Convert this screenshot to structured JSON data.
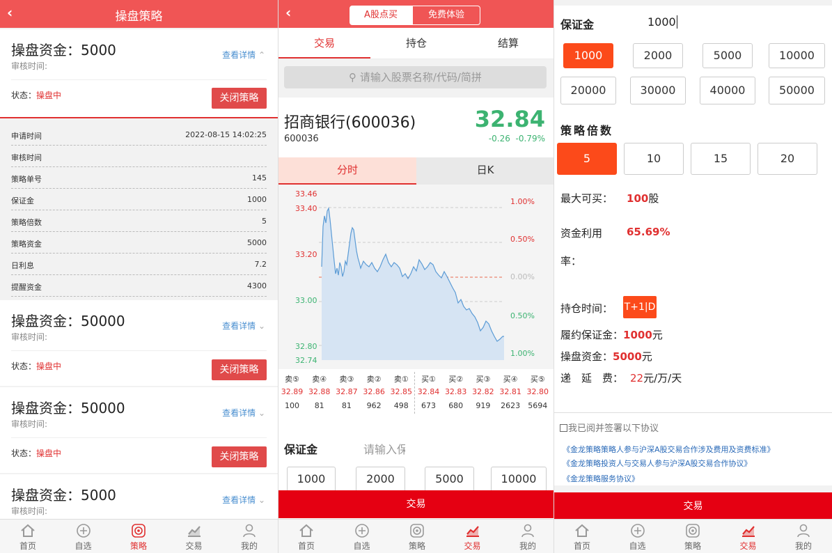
{
  "panel1": {
    "title": "操盘策略",
    "cards": [
      {
        "fund": "操盘资金：5000",
        "audit": "审核时间:",
        "detail": "查看详情",
        "status_label": "状态：",
        "status": "操盘中",
        "close": "关闭策略"
      },
      {
        "fund": "操盘资金：50000",
        "audit": "审核时间:",
        "detail": "查看详情",
        "status_label": "状态：",
        "status": "操盘中",
        "close": "关闭策略"
      },
      {
        "fund": "操盘资金：50000",
        "audit": "审核时间:",
        "detail": "查看详情",
        "status_label": "状态：",
        "status": "操盘中",
        "close": "关闭策略"
      },
      {
        "fund": "操盘资金：5000",
        "audit": "审核时间:",
        "detail": "查看详情"
      }
    ],
    "details": [
      {
        "k": "申请时间",
        "v": "2022-08-15 14:02:25"
      },
      {
        "k": "审核时间",
        "v": ""
      },
      {
        "k": "策略单号",
        "v": "145"
      },
      {
        "k": "保证金",
        "v": "1000"
      },
      {
        "k": "策略倍数",
        "v": "5"
      },
      {
        "k": "策略资金",
        "v": "5000"
      },
      {
        "k": "日利息",
        "v": "7.2"
      },
      {
        "k": "提醒资金",
        "v": "4300"
      }
    ]
  },
  "tabbar": [
    {
      "label": "首页",
      "icon": "home-icon"
    },
    {
      "label": "自选",
      "icon": "plus-circle-icon"
    },
    {
      "label": "策略",
      "icon": "target-icon"
    },
    {
      "label": "交易",
      "icon": "trend-chart-icon"
    },
    {
      "label": "我的",
      "icon": "user-icon"
    }
  ],
  "panel2": {
    "seg_left": "A股点买",
    "seg_right": "免费体验",
    "tabs": [
      "交易",
      "持仓",
      "结算"
    ],
    "search_placeholder": "请输入股票名称/代码/简拼",
    "stock_name": "招商银行(600036)",
    "stock_code": "600036",
    "price": "32.84",
    "change": "-0.26",
    "change_pct": "-0.79%",
    "chart_tabs": [
      "分时",
      "日K"
    ],
    "y_left": [
      "33.46",
      "33.40",
      "33.20",
      "33.00",
      "32.80",
      "32.74"
    ],
    "y_right": [
      "1.00%",
      "0.50%",
      "0.00%",
      "0.50%",
      "1.00%"
    ],
    "orderbook": {
      "labels": [
        "卖⑤",
        "卖④",
        "卖③",
        "卖②",
        "卖①",
        "买①",
        "买②",
        "买③",
        "买④",
        "买⑤"
      ],
      "prices": [
        "32.89",
        "32.88",
        "32.87",
        "32.86",
        "32.85",
        "32.84",
        "32.83",
        "32.82",
        "32.81",
        "32.80"
      ],
      "volumes": [
        "100",
        "81",
        "81",
        "962",
        "498",
        "673",
        "680",
        "919",
        "2623",
        "5694"
      ]
    },
    "margin_label": "保证金",
    "margin_placeholder": "请输入保",
    "amounts": [
      "1000",
      "2000",
      "5000",
      "10000"
    ],
    "trade": "交易"
  },
  "panel3": {
    "margin_label": "保证金",
    "margin_value": "1000",
    "amounts": [
      "1000",
      "2000",
      "5000",
      "10000",
      "20000",
      "30000",
      "40000",
      "50000"
    ],
    "multiple_label": "策略倍数",
    "multiples": [
      "5",
      "10",
      "15",
      "20"
    ],
    "max_buy_label": "最大可买：",
    "max_buy_value": "100",
    "max_buy_unit": "股",
    "util_label_1": "资金利用",
    "util_label_2": "率：",
    "util_value": "65.69%",
    "hold_label": "持仓时间：",
    "hold_value": "T+1|D",
    "deposit_label": "履约保证金：",
    "deposit_value": "1000",
    "deposit_unit": "元",
    "fund_label": "操盘资金：",
    "fund_value": "5000",
    "fund_unit": "元",
    "fee_label": "递　延　费：",
    "fee_value": "22",
    "fee_unit": "元/万/天",
    "agree": "我已阅并签署以下协议",
    "links": [
      "《金龙策略策略人参与沪深A股交易合作涉及费用及资费标准》",
      "《金龙策略投资人与交易人参与沪深A股交易合作协议》",
      "《金龙策略服务协议》"
    ],
    "trade": "交易"
  },
  "colors": {
    "brand": "#f05555",
    "accent": "#fc4a1a",
    "up": "#e03030",
    "down": "#3cb371"
  }
}
